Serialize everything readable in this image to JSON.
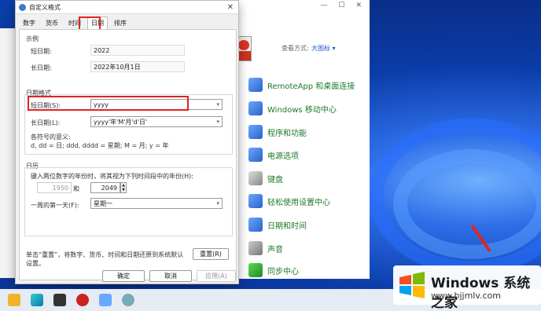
{
  "dialog": {
    "title": "自定义格式",
    "tabs": [
      "数字",
      "货币",
      "时间",
      "日期",
      "排序"
    ],
    "active_tab": "日期",
    "example": {
      "group": "示例",
      "short_label": "短日期:",
      "short_value": "2022",
      "long_label": "长日期:",
      "long_value": "2022年10月1日"
    },
    "date_formats": {
      "group": "日期格式",
      "short_label": "短日期(S):",
      "short_value": "yyyy",
      "long_label": "长日期(L):",
      "long_value": "yyyy'年'M'月'd'日'",
      "legend_title": "各符号的意义:",
      "legend_text": "d, dd = 日; ddd, dddd = 星期; M = 月; y = 年"
    },
    "calendar": {
      "group": "日历",
      "description": "键入两位数字的年份时，将其视为下列时间段中的年份(H):",
      "from_year": "1950",
      "and_label": "和",
      "to_year": "2049",
      "first_day_label": "一周的第一天(F):",
      "first_day_value": "星期一"
    },
    "reset_hint": "单击“重置”，将数字、货币、时间和日期还原到系统默认设置。",
    "reset_button": "重置(R)",
    "ok_button": "确定",
    "cancel_button": "取消",
    "apply_button": "应用(A)"
  },
  "control_panel": {
    "view_label": "查看方式:",
    "view_value": "大图标 ▾",
    "items": [
      "RemoteApp 和桌面连接",
      "Windows 移动中心",
      "程序和功能",
      "电源选项",
      "键盘",
      "轻松使用设置中心",
      "日期和时间",
      "声音",
      "同步中心"
    ]
  },
  "watermark": {
    "title": "Windows 系统之家",
    "url": "www.bjjmlv.com"
  },
  "colors": {
    "highlight": "#e02424",
    "link_green": "#1d7a2a"
  }
}
